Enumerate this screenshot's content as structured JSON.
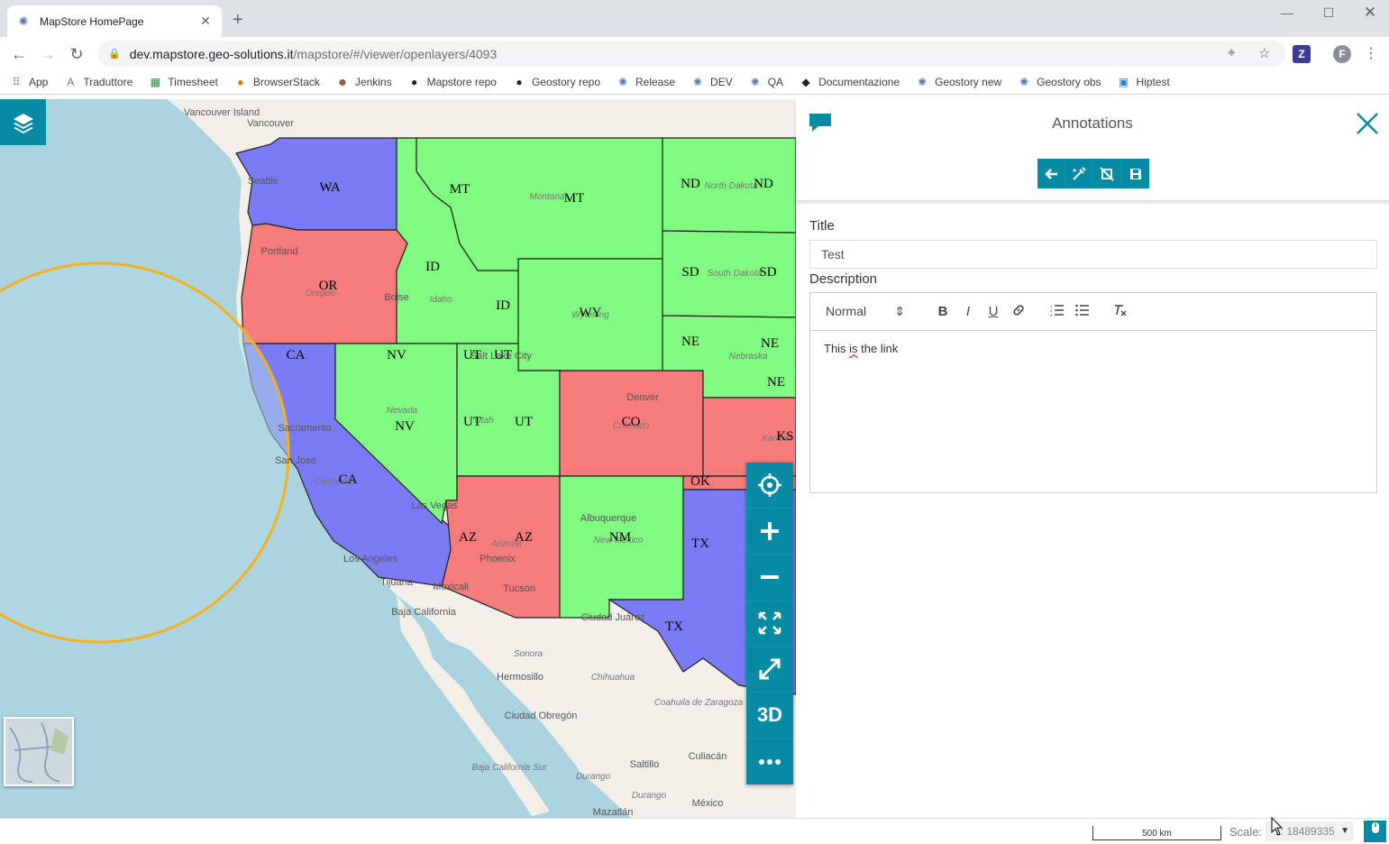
{
  "browser": {
    "tab_title": "MapStore HomePage",
    "new_tab": "+",
    "url_host": "dev.mapstore.geo-solutions.it",
    "url_path": "/mapstore/#/viewer/openlayers/4093",
    "profile_initial": "F",
    "ext_label": "Z"
  },
  "bookmarks": [
    {
      "label": "App",
      "icon": "apps-grid-icon"
    },
    {
      "label": "Traduttore",
      "icon": "translate-icon"
    },
    {
      "label": "Timesheet",
      "icon": "sheets-icon"
    },
    {
      "label": "BrowserStack",
      "icon": "browserstack-icon"
    },
    {
      "label": "Jenkins",
      "icon": "jenkins-icon"
    },
    {
      "label": "Mapstore repo",
      "icon": "github-icon"
    },
    {
      "label": "Geostory repo",
      "icon": "github-icon"
    },
    {
      "label": "Release",
      "icon": "mapstore-icon"
    },
    {
      "label": "DEV",
      "icon": "mapstore-icon"
    },
    {
      "label": "QA",
      "icon": "mapstore-icon"
    },
    {
      "label": "Documentazione",
      "icon": "graduation-cap-icon"
    },
    {
      "label": "Geostory new",
      "icon": "mapstore-icon"
    },
    {
      "label": "Geostory obs",
      "icon": "mapstore-icon"
    },
    {
      "label": "Hiptest",
      "icon": "hiptest-icon"
    }
  ],
  "map": {
    "state_labels": [
      {
        "code": "WA"
      },
      {
        "code": "OR"
      },
      {
        "code": "CA"
      },
      {
        "code": "CA"
      },
      {
        "code": "MT"
      },
      {
        "code": "MT"
      },
      {
        "code": "ID"
      },
      {
        "code": "ID"
      },
      {
        "code": "NV"
      },
      {
        "code": "NV"
      },
      {
        "code": "UT"
      },
      {
        "code": "UT"
      },
      {
        "code": "UT"
      },
      {
        "code": "UT"
      },
      {
        "code": "WY"
      },
      {
        "code": "CO"
      },
      {
        "code": "AZ"
      },
      {
        "code": "AZ"
      },
      {
        "code": "NM"
      },
      {
        "code": "ND"
      },
      {
        "code": "ND"
      },
      {
        "code": "SD"
      },
      {
        "code": "SD"
      },
      {
        "code": "NE"
      },
      {
        "code": "NE"
      },
      {
        "code": "NE"
      },
      {
        "code": "KS"
      },
      {
        "code": "OK"
      },
      {
        "code": "TX"
      },
      {
        "code": "TX"
      }
    ],
    "place_labels": [
      "Vancouver Island",
      "Vancouver",
      "Seattle",
      "Portland",
      "Oregon",
      "Boise",
      "Idaho",
      "Montana",
      "North Dakota",
      "South Dakota",
      "Nebraska",
      "Wyoming",
      "Salt Lake City",
      "Nevada",
      "Utah",
      "Denver",
      "Colorado",
      "Kansas",
      "Sacramento",
      "San Jose",
      "California",
      "Las Vegas",
      "Los Angeles",
      "Tijuana",
      "Mexicali",
      "Arizona",
      "Phoenix",
      "Tucson",
      "Albuquerque",
      "New Mexico",
      "Ciudad Juárez",
      "Baja California",
      "Sonora",
      "Hermosillo",
      "Chihuahua",
      "Coahuila de Zaragoza",
      "Ciudad Obregón",
      "Baja California Sur",
      "Durango",
      "Saltillo",
      "Culiacán",
      "Durango",
      "México",
      "Mazatlán"
    ],
    "colors": {
      "blue": "#7b7bf5",
      "green": "#80fa80",
      "red": "#f67b7b",
      "water": "#aad3df",
      "land": "#f2efe9",
      "circle": "#f2b01e"
    }
  },
  "map_toolbar": {
    "locate": "locate-icon",
    "zoom_in": "plus-icon",
    "zoom_out": "minus-icon",
    "zoom_full": "expand-arrows-icon",
    "fullscreen": "fullscreen-icon",
    "three_d": "3D",
    "more": "more-icon"
  },
  "panel": {
    "heading": "Annotations",
    "buttons": [
      "back-arrow-icon",
      "edit-geometry-icon",
      "delete-geometry-icon",
      "save-icon"
    ],
    "title_label": "Title",
    "title_value": "Test",
    "description_label": "Description",
    "format_select": "Normal",
    "format_tools": [
      "B",
      "I",
      "U",
      "link-icon",
      "ordered-list-icon",
      "bullet-list-icon",
      "clear-format-icon"
    ],
    "description_text_a": "This ",
    "description_text_b": "is",
    "description_text_c": " the link"
  },
  "footer": {
    "scale_bar": "500 km",
    "scale_label": "Scale:",
    "scale_value": "1: 18489335"
  }
}
